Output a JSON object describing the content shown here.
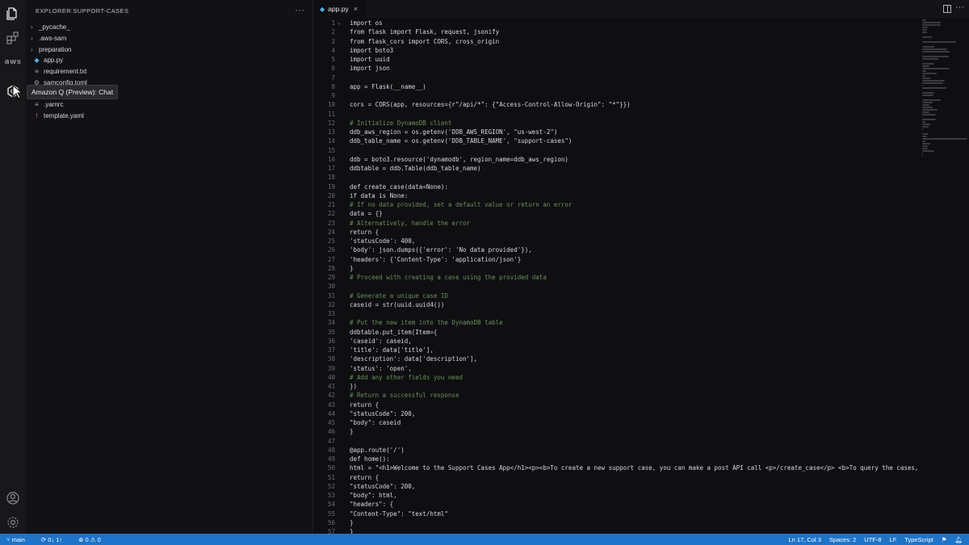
{
  "explorer": {
    "title": "EXPLORER:SUPPORT-CASES",
    "more": "···",
    "items": [
      {
        "label": "_pycache_",
        "kind": "folder",
        "icon": "chevron-right"
      },
      {
        "label": ".aws-sam",
        "kind": "folder",
        "icon": "chevron-right"
      },
      {
        "label": "preparation",
        "kind": "folder",
        "icon": "chevron-right"
      },
      {
        "label": "app.py",
        "kind": "file",
        "icon": "python-file"
      },
      {
        "label": "requirement.txt",
        "kind": "file",
        "icon": "text-file"
      },
      {
        "label": "samconfig.toml",
        "kind": "file",
        "icon": "settings-file"
      },
      {
        "label": "",
        "kind": "file",
        "icon": "file"
      },
      {
        "label": ".yarnrc",
        "kind": "file",
        "icon": "text-file"
      },
      {
        "label": "template.yaml",
        "kind": "file",
        "icon": "yaml-file"
      }
    ]
  },
  "activity": {
    "aws_label": "aws",
    "tooltip": "Amazon Q (Preview): Chat"
  },
  "editor": {
    "tab_label": "app.py",
    "tab_close": "×",
    "more": "···",
    "lines": [
      {
        "n": "1",
        "t": "import os",
        "f": "⌄"
      },
      {
        "n": "2",
        "t": "from flask import Flask, request, jsonify"
      },
      {
        "n": "3",
        "t": "from flask_cors import CORS, cross_origin"
      },
      {
        "n": "4",
        "t": "import boto3"
      },
      {
        "n": "5",
        "t": "import uuid"
      },
      {
        "n": "6",
        "t": "import json"
      },
      {
        "n": "7",
        "t": ""
      },
      {
        "n": "8",
        "t": "app = Flask(__name__)"
      },
      {
        "n": "9",
        "t": ""
      },
      {
        "n": "10",
        "t": "cors = CORS(app, resources={r\"/api/*\": {\"Access-Control-Allow-Origin\": \"*\"}})"
      },
      {
        "n": "11",
        "t": ""
      },
      {
        "n": "12",
        "t": "# Initialize DynamoDB client",
        "c": true
      },
      {
        "n": "13",
        "t": "ddb_aws_region = os.getenv('DDB_AWS_REGION', \"us-west-2\")"
      },
      {
        "n": "14",
        "t": "ddb_table_name = os.getenv('DDB_TABLE_NAME', \"support-cases\")"
      },
      {
        "n": "15",
        "t": ""
      },
      {
        "n": "16",
        "t": "ddb = boto3.resource('dynamodb', region_name=ddb_aws_region)"
      },
      {
        "n": "17",
        "t": "ddbtable = ddb.Table(ddb_table_name)"
      },
      {
        "n": "18",
        "t": ""
      },
      {
        "n": "19",
        "t": "def create_case(data=None):"
      },
      {
        "n": "20",
        "t": "if data is None:"
      },
      {
        "n": "21",
        "t": "# If no data provided, set a default value or return an error",
        "c": true
      },
      {
        "n": "22",
        "t": "data = {}"
      },
      {
        "n": "23",
        "t": "# Alternatively, handle the error",
        "c": true
      },
      {
        "n": "24",
        "t": "return {"
      },
      {
        "n": "25",
        "t": "'statusCode': 400,"
      },
      {
        "n": "26",
        "t": "'body': json.dumps({'error': 'No data provided'}),"
      },
      {
        "n": "27",
        "t": "'headers': {'Content-Type': 'application/json'}"
      },
      {
        "n": "28",
        "t": "}"
      },
      {
        "n": "29",
        "t": "# Proceed with creating a case using the provided data",
        "c": true
      },
      {
        "n": "30",
        "t": ""
      },
      {
        "n": "31",
        "t": "# Generate a unique case ID",
        "c": true
      },
      {
        "n": "32",
        "t": "caseid = str(uuid.uuid4())"
      },
      {
        "n": "33",
        "t": ""
      },
      {
        "n": "34",
        "t": "# Put the new item into the DynamoDB table",
        "c": true
      },
      {
        "n": "35",
        "t": "ddbtable.put_item(Item={"
      },
      {
        "n": "36",
        "t": "'caseid': caseid,"
      },
      {
        "n": "37",
        "t": "'title': data['title'],"
      },
      {
        "n": "38",
        "t": "'description': data['description'],"
      },
      {
        "n": "39",
        "t": "'status': 'open',"
      },
      {
        "n": "40",
        "t": "# Add any other fields you need",
        "c": true
      },
      {
        "n": "41",
        "t": "})"
      },
      {
        "n": "42",
        "t": "# Return a successful response",
        "c": true
      },
      {
        "n": "43",
        "t": "return {"
      },
      {
        "n": "44",
        "t": "\"statusCode\": 200,"
      },
      {
        "n": "45",
        "t": "\"body\": caseid"
      },
      {
        "n": "46",
        "t": "}"
      },
      {
        "n": "47",
        "t": ""
      },
      {
        "n": "48",
        "t": "@app.route('/')"
      },
      {
        "n": "49",
        "t": "def home():"
      },
      {
        "n": "50",
        "t": "html = \"<h1>Welcome to the Support Cases App</h1><p><b>To create a new support case, you can make a post API call <p>/create_case</p> <b>To query the cases,"
      },
      {
        "n": "51",
        "t": "return {"
      },
      {
        "n": "52",
        "t": "\"statusCode\": 200,"
      },
      {
        "n": "53",
        "t": "\"body\": html,"
      },
      {
        "n": "54",
        "t": "\"headers\": {"
      },
      {
        "n": "55",
        "t": "\"Content-Type\": \"text/html\""
      },
      {
        "n": "56",
        "t": "}"
      },
      {
        "n": "57",
        "t": "}"
      }
    ]
  },
  "statusbar": {
    "branch": "main",
    "sync": "0↓ 1↑",
    "problems": "⊗ 0 ⚠ 0",
    "position": "Ln 17, Col 3",
    "spaces": "Spaces: 2",
    "encoding": "UTF-8",
    "eol": "LF",
    "language": "TypeScript"
  }
}
